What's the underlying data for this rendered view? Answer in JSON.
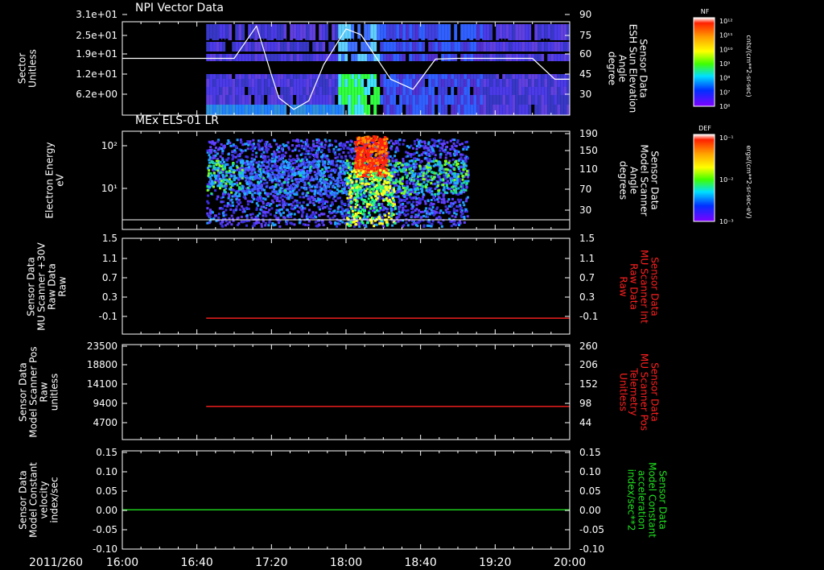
{
  "chart_data": [
    {
      "id": "npi",
      "type": "heatmap",
      "title": "NPI Vector Data",
      "left_axis": {
        "label_lines": [
          "Sector",
          "Unitless"
        ],
        "ticks": [
          "3.1e+01",
          "2.5e+01",
          "1.9e+01",
          "1.2e+01",
          "6.2e+00"
        ]
      },
      "right_axis": {
        "label_lines": [
          "Sensor Data",
          "ESH Sun Elevation",
          "Angle",
          "degree"
        ],
        "ticks": [
          90,
          75,
          60,
          45,
          30
        ],
        "ylim": [
          20,
          90
        ]
      },
      "overlay_series": {
        "name": "ESH Sun Elevation Angle",
        "x": [
          "16:00",
          "17:00",
          "17:12",
          "17:20",
          "17:24",
          "17:32",
          "17:40",
          "17:48",
          "18:00",
          "18:08",
          "18:24",
          "18:36",
          "18:48",
          "19:00",
          "19:40",
          "19:52",
          "20:00"
        ],
        "y": [
          59.5,
          59.5,
          82,
          48,
          32,
          24,
          30,
          55,
          80,
          76,
          45,
          38,
          59,
          59.5,
          59.5,
          45,
          45
        ]
      },
      "colorbar": {
        "label": "NF",
        "unit": "cnts/(cm**2-sr-sec)",
        "ticks": [
          "10¹²",
          "10¹¹",
          "10¹⁰",
          "10⁹",
          "10⁸",
          "10⁷",
          "10⁶"
        ]
      }
    },
    {
      "id": "els",
      "type": "heatmap",
      "title": "MEx ELS-01 LR",
      "left_axis": {
        "label_lines": [
          "Electron Energy",
          "eV"
        ],
        "ticks": [
          "10²",
          "10¹"
        ]
      },
      "right_axis": {
        "label_lines": [
          "Sensor Data",
          "Model Scanner",
          "Angle",
          "degrees"
        ],
        "ticks": [
          190,
          150,
          110,
          70,
          30
        ],
        "ylim": [
          0,
          190
        ]
      },
      "overlay_series": {
        "name": "Model Scanner Angle",
        "x": [
          "16:00",
          "20:00"
        ],
        "y": [
          10,
          10
        ]
      },
      "colorbar": {
        "label": "DEF",
        "unit": "ergs/(cm**2-sr-sec-eV)",
        "ticks": [
          "10⁻¹",
          "10⁻²",
          "10⁻³"
        ]
      }
    },
    {
      "id": "raw",
      "type": "line",
      "left_axis": {
        "label_lines": [
          "Sensor Data",
          "MU Scanner +30V",
          "Raw Data",
          "Raw"
        ],
        "ticks": [
          1.5,
          1.1,
          0.7,
          0.3,
          -0.1
        ],
        "ylim": [
          -0.3,
          1.5
        ]
      },
      "right_axis": {
        "label_lines": [
          "Sensor Data",
          "MU Scanner Int",
          "Raw Data",
          "Raw"
        ],
        "ticks": [
          1.5,
          1.1,
          0.7,
          0.3,
          -0.1
        ],
        "color": "#ff2020"
      },
      "series": [
        {
          "x": [
            "16:45",
            "20:00"
          ],
          "y": [
            0.0,
            0.0
          ],
          "color": "#ff2020"
        }
      ]
    },
    {
      "id": "pos",
      "type": "line",
      "left_axis": {
        "label_lines": [
          "Sensor Data",
          "Model Scanner Pos",
          "Raw",
          "unitless"
        ],
        "ticks": [
          23500,
          18800,
          14100,
          9400,
          4700
        ],
        "ylim": [
          0,
          23500
        ]
      },
      "right_axis": {
        "label_lines": [
          "Sensor Data",
          "MU Scanner Pos",
          "Telemetry",
          "Unitless"
        ],
        "ticks": [
          260,
          206,
          152,
          98,
          44
        ],
        "color": "#ff2020"
      },
      "series": [
        {
          "x": [
            "16:45",
            "20:00"
          ],
          "y": [
            8200,
            8200
          ],
          "color": "#ff2020"
        }
      ]
    },
    {
      "id": "vel",
      "type": "line",
      "left_axis": {
        "label_lines": [
          "Sensor Data",
          "Model Constant",
          "velocity",
          "index/sec"
        ],
        "ticks": [
          "0.15",
          "0.10",
          "0.05",
          "0.00",
          "-0.05",
          "-0.10"
        ],
        "ylim": [
          -0.1,
          0.15
        ]
      },
      "right_axis": {
        "label_lines": [
          "Sensor Data",
          "Model Constant",
          "acceleration",
          "index/sec**2"
        ],
        "ticks": [
          "0.15",
          "0.10",
          "0.05",
          "0.00",
          "-0.05",
          "-0.10"
        ],
        "color": "#20e020"
      },
      "series": [
        {
          "x": [
            "16:00",
            "20:00"
          ],
          "y": [
            0.0,
            0.0
          ],
          "color": "#20e020"
        }
      ]
    }
  ],
  "time_axis": {
    "date": "2011/260",
    "ticks": [
      "16:00",
      "16:40",
      "17:20",
      "18:00",
      "18:40",
      "19:20",
      "20:00"
    ],
    "range": [
      "16:00",
      "20:00"
    ]
  }
}
